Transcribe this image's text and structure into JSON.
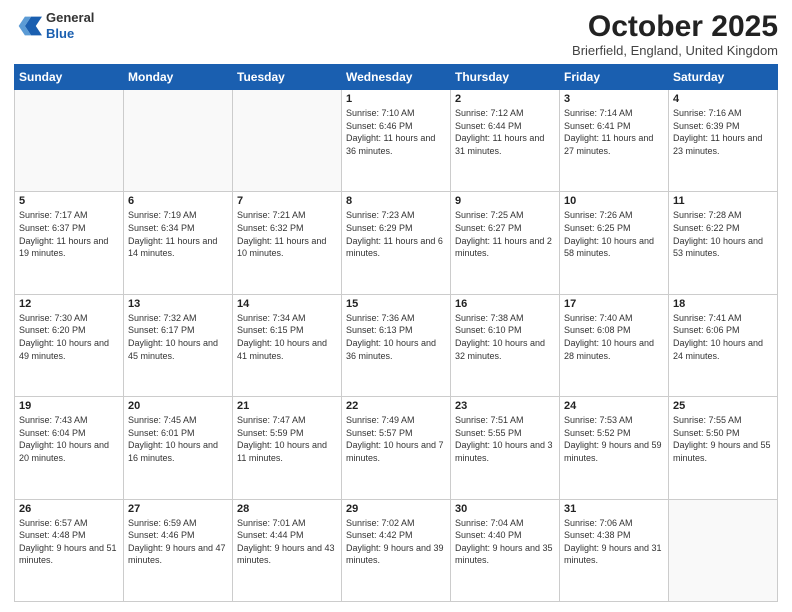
{
  "logo": {
    "general": "General",
    "blue": "Blue"
  },
  "header": {
    "month": "October 2025",
    "location": "Brierfield, England, United Kingdom"
  },
  "days_of_week": [
    "Sunday",
    "Monday",
    "Tuesday",
    "Wednesday",
    "Thursday",
    "Friday",
    "Saturday"
  ],
  "weeks": [
    [
      {
        "num": "",
        "info": ""
      },
      {
        "num": "",
        "info": ""
      },
      {
        "num": "",
        "info": ""
      },
      {
        "num": "1",
        "info": "Sunrise: 7:10 AM\nSunset: 6:46 PM\nDaylight: 11 hours\nand 36 minutes."
      },
      {
        "num": "2",
        "info": "Sunrise: 7:12 AM\nSunset: 6:44 PM\nDaylight: 11 hours\nand 31 minutes."
      },
      {
        "num": "3",
        "info": "Sunrise: 7:14 AM\nSunset: 6:41 PM\nDaylight: 11 hours\nand 27 minutes."
      },
      {
        "num": "4",
        "info": "Sunrise: 7:16 AM\nSunset: 6:39 PM\nDaylight: 11 hours\nand 23 minutes."
      }
    ],
    [
      {
        "num": "5",
        "info": "Sunrise: 7:17 AM\nSunset: 6:37 PM\nDaylight: 11 hours\nand 19 minutes."
      },
      {
        "num": "6",
        "info": "Sunrise: 7:19 AM\nSunset: 6:34 PM\nDaylight: 11 hours\nand 14 minutes."
      },
      {
        "num": "7",
        "info": "Sunrise: 7:21 AM\nSunset: 6:32 PM\nDaylight: 11 hours\nand 10 minutes."
      },
      {
        "num": "8",
        "info": "Sunrise: 7:23 AM\nSunset: 6:29 PM\nDaylight: 11 hours\nand 6 minutes."
      },
      {
        "num": "9",
        "info": "Sunrise: 7:25 AM\nSunset: 6:27 PM\nDaylight: 11 hours\nand 2 minutes."
      },
      {
        "num": "10",
        "info": "Sunrise: 7:26 AM\nSunset: 6:25 PM\nDaylight: 10 hours\nand 58 minutes."
      },
      {
        "num": "11",
        "info": "Sunrise: 7:28 AM\nSunset: 6:22 PM\nDaylight: 10 hours\nand 53 minutes."
      }
    ],
    [
      {
        "num": "12",
        "info": "Sunrise: 7:30 AM\nSunset: 6:20 PM\nDaylight: 10 hours\nand 49 minutes."
      },
      {
        "num": "13",
        "info": "Sunrise: 7:32 AM\nSunset: 6:17 PM\nDaylight: 10 hours\nand 45 minutes."
      },
      {
        "num": "14",
        "info": "Sunrise: 7:34 AM\nSunset: 6:15 PM\nDaylight: 10 hours\nand 41 minutes."
      },
      {
        "num": "15",
        "info": "Sunrise: 7:36 AM\nSunset: 6:13 PM\nDaylight: 10 hours\nand 36 minutes."
      },
      {
        "num": "16",
        "info": "Sunrise: 7:38 AM\nSunset: 6:10 PM\nDaylight: 10 hours\nand 32 minutes."
      },
      {
        "num": "17",
        "info": "Sunrise: 7:40 AM\nSunset: 6:08 PM\nDaylight: 10 hours\nand 28 minutes."
      },
      {
        "num": "18",
        "info": "Sunrise: 7:41 AM\nSunset: 6:06 PM\nDaylight: 10 hours\nand 24 minutes."
      }
    ],
    [
      {
        "num": "19",
        "info": "Sunrise: 7:43 AM\nSunset: 6:04 PM\nDaylight: 10 hours\nand 20 minutes."
      },
      {
        "num": "20",
        "info": "Sunrise: 7:45 AM\nSunset: 6:01 PM\nDaylight: 10 hours\nand 16 minutes."
      },
      {
        "num": "21",
        "info": "Sunrise: 7:47 AM\nSunset: 5:59 PM\nDaylight: 10 hours\nand 11 minutes."
      },
      {
        "num": "22",
        "info": "Sunrise: 7:49 AM\nSunset: 5:57 PM\nDaylight: 10 hours\nand 7 minutes."
      },
      {
        "num": "23",
        "info": "Sunrise: 7:51 AM\nSunset: 5:55 PM\nDaylight: 10 hours\nand 3 minutes."
      },
      {
        "num": "24",
        "info": "Sunrise: 7:53 AM\nSunset: 5:52 PM\nDaylight: 9 hours\nand 59 minutes."
      },
      {
        "num": "25",
        "info": "Sunrise: 7:55 AM\nSunset: 5:50 PM\nDaylight: 9 hours\nand 55 minutes."
      }
    ],
    [
      {
        "num": "26",
        "info": "Sunrise: 6:57 AM\nSunset: 4:48 PM\nDaylight: 9 hours\nand 51 minutes."
      },
      {
        "num": "27",
        "info": "Sunrise: 6:59 AM\nSunset: 4:46 PM\nDaylight: 9 hours\nand 47 minutes."
      },
      {
        "num": "28",
        "info": "Sunrise: 7:01 AM\nSunset: 4:44 PM\nDaylight: 9 hours\nand 43 minutes."
      },
      {
        "num": "29",
        "info": "Sunrise: 7:02 AM\nSunset: 4:42 PM\nDaylight: 9 hours\nand 39 minutes."
      },
      {
        "num": "30",
        "info": "Sunrise: 7:04 AM\nSunset: 4:40 PM\nDaylight: 9 hours\nand 35 minutes."
      },
      {
        "num": "31",
        "info": "Sunrise: 7:06 AM\nSunset: 4:38 PM\nDaylight: 9 hours\nand 31 minutes."
      },
      {
        "num": "",
        "info": ""
      }
    ]
  ]
}
